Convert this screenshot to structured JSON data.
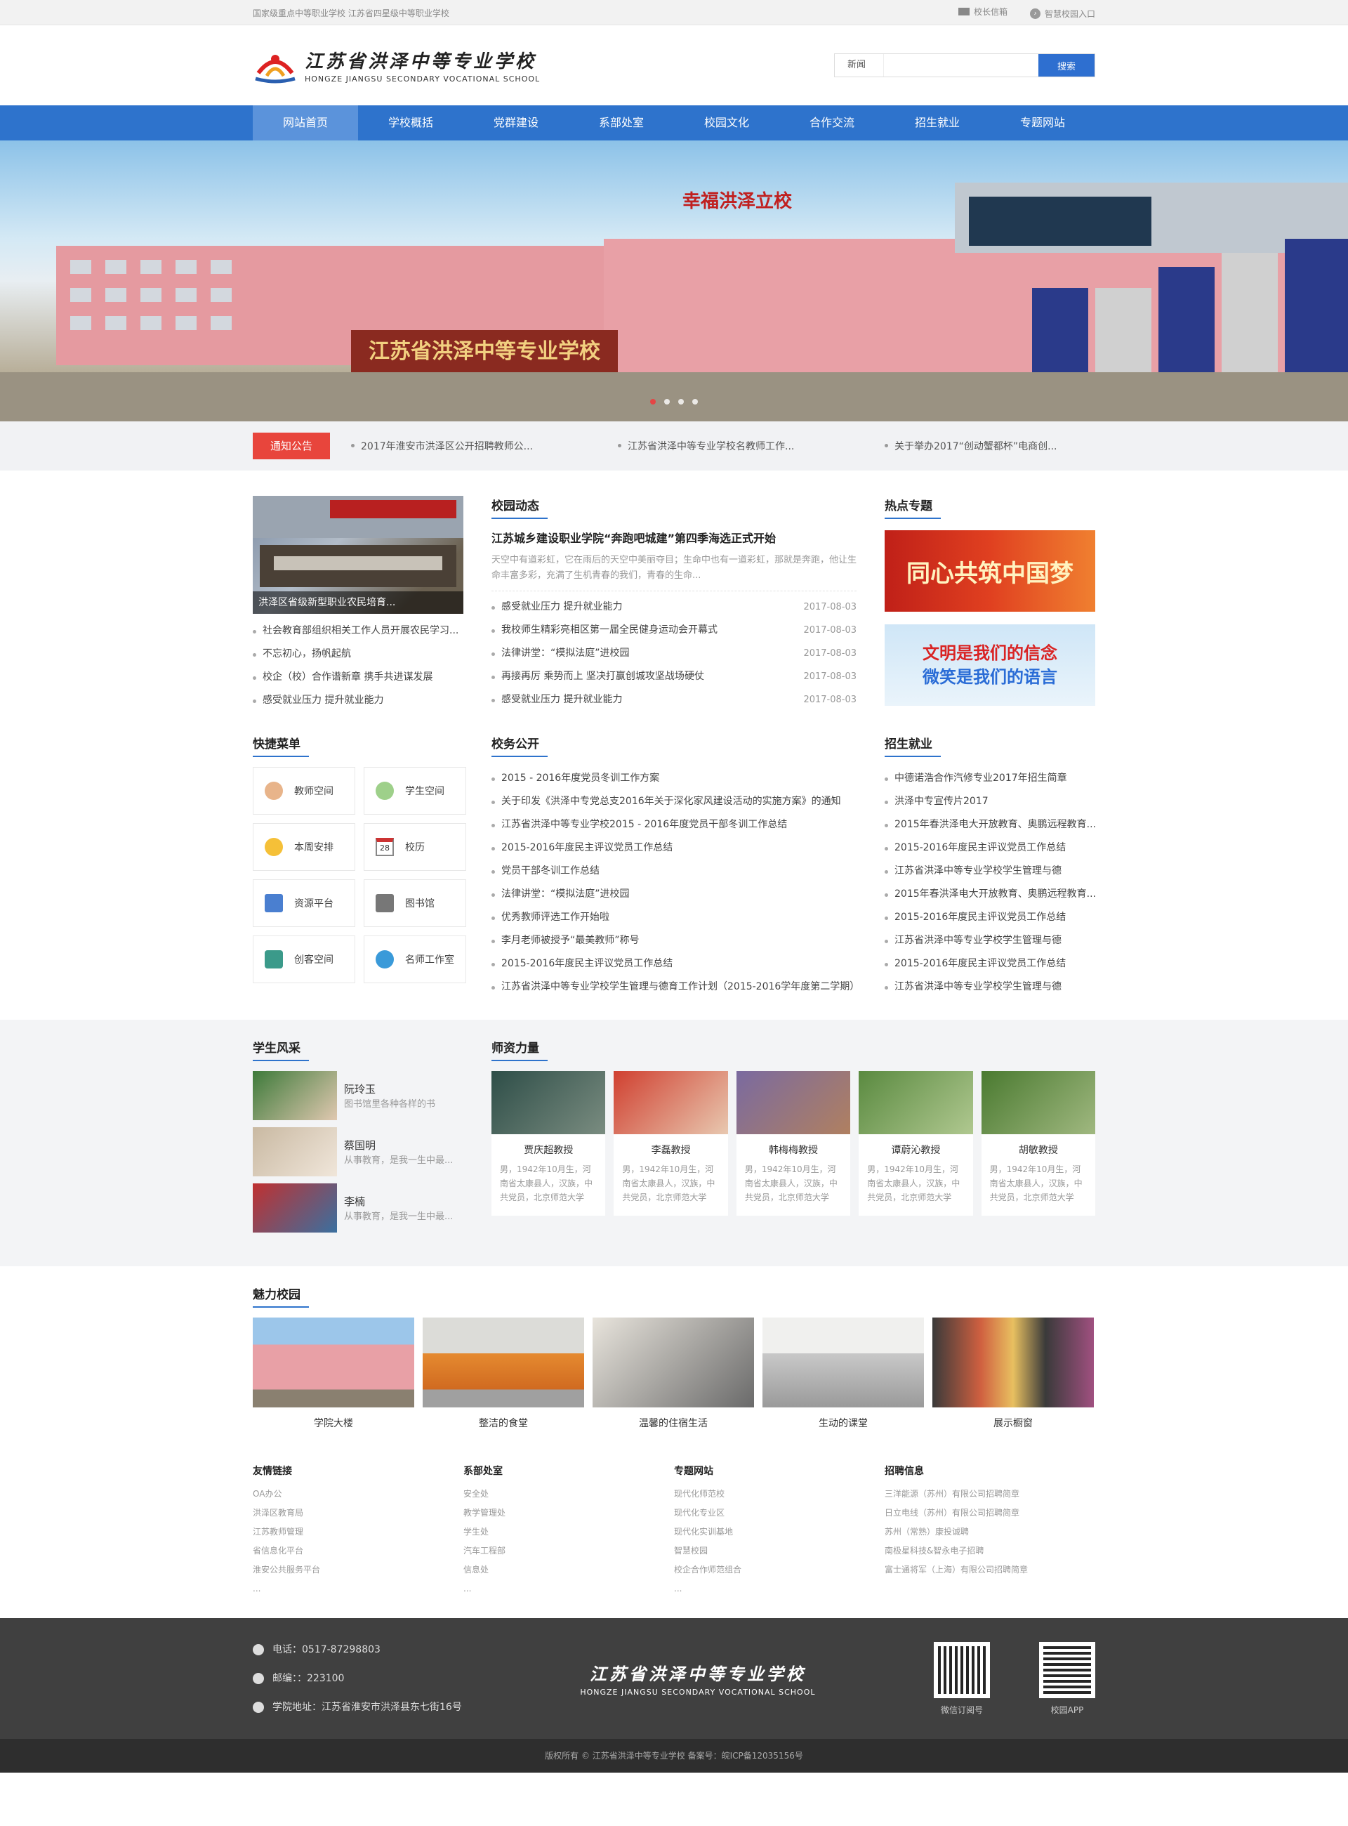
{
  "topbar": {
    "left": "国家级重点中等职业学校    江苏省四星级中等职业学校",
    "principal_mail": "校长信箱",
    "smart_campus": "智慧校园入口"
  },
  "logo": {
    "cn": "江苏省洪泽中等专业学校",
    "en": "HONGZE JIANGSU SECONDARY VOCATIONAL SCHOOL"
  },
  "search": {
    "label": "新闻",
    "placeholder": "",
    "button": "搜索"
  },
  "nav": [
    "网站首页",
    "学校概括",
    "党群建设",
    "系部处室",
    "校园文化",
    "合作交流",
    "招生就业",
    "专题网站"
  ],
  "banner": {
    "sign": "江苏省洪泽中等专业学校",
    "slogan": "幸福洪泽立校"
  },
  "notice": {
    "tag": "通知公告",
    "items": [
      "2017年淮安市洪泽区公开招聘教师公...",
      "江苏省洪泽中等专业学校名教师工作...",
      "关于举办2017“创动蟹都杯”电商创..."
    ]
  },
  "photo_caption": "洪泽区省级新型职业农民培育...",
  "left_list": [
    "社会教育部组织相关工作人员开展农民学习...",
    "不忘初心，扬帆起航",
    "校企（校）合作谱新章 携手共进谋发展",
    "感受就业压力 提升就业能力"
  ],
  "campus": {
    "title": "校园动态",
    "headline": "江苏城乡建设职业学院“奔跑吧城建”第四季海选正式开始",
    "summary": "天空中有道彩虹，它在雨后的天空中美丽夺目；生命中也有一道彩虹，那就是奔跑，他让生命丰富多彩，充满了生机青春的我们，青春的生命...",
    "items": [
      {
        "t": "感受就业压力 提升就业能力",
        "d": "2017-08-03"
      },
      {
        "t": "我校师生精彩亮相区第一届全民健身运动会开幕式",
        "d": "2017-08-03"
      },
      {
        "t": "法律讲堂：“模拟法庭”进校园",
        "d": "2017-08-03"
      },
      {
        "t": "再接再厉 乘势而上 坚决打赢创城攻坚战场硬仗",
        "d": "2017-08-03"
      },
      {
        "t": "感受就业压力 提升就业能力",
        "d": "2017-08-03"
      }
    ]
  },
  "hot": {
    "title": "热点专题",
    "b1": "同心共筑中国梦",
    "b2a": "文明是我们的信念",
    "b2b": "微笑是我们的语言"
  },
  "quick": {
    "title": "快捷菜单",
    "items": [
      "教师空间",
      "学生空间",
      "本周安排",
      "校历",
      "资源平台",
      "图书馆",
      "创客空间",
      "名师工作室"
    ],
    "cal": "28"
  },
  "affairs": {
    "title": "校务公开",
    "items": [
      "2015 - 2016年度党员冬训工作方案",
      "关于印发《洪泽中专党总支2016年关于深化家风建设活动的实施方案》的通知",
      "江苏省洪泽中等专业学校2015 - 2016年度党员干部冬训工作总结",
      "2015-2016年度民主评议党员工作总结",
      "党员干部冬训工作总结",
      "法律讲堂：“模拟法庭”进校园",
      "优秀教师评选工作开始啦",
      "李月老师被授予“最美教师”称号",
      "2015-2016年度民主评议党员工作总结",
      "江苏省洪泽中等专业学校学生管理与德育工作计划（2015-2016学年度第二学期）"
    ]
  },
  "enroll": {
    "title": "招生就业",
    "items": [
      "中德诺浩合作汽修专业2017年招生简章",
      "洪泽中专宣传片2017",
      "2015年春洪泽电大开放教育、奥鹏远程教育...",
      "2015-2016年度民主评议党员工作总结",
      "江苏省洪泽中等专业学校学生管理与德",
      "2015年春洪泽电大开放教育、奥鹏远程教育...",
      "2015-2016年度民主评议党员工作总结",
      "江苏省洪泽中等专业学校学生管理与德",
      "2015-2016年度民主评议党员工作总结",
      "江苏省洪泽中等专业学校学生管理与德"
    ]
  },
  "students": {
    "title": "学生风采",
    "items": [
      {
        "n": "阮玲玉",
        "d": "图书馆里各种各样的书"
      },
      {
        "n": "蔡国明",
        "d": "从事教育，是我一生中最..."
      },
      {
        "n": "李楠",
        "d": "从事教育，是我一生中最..."
      }
    ]
  },
  "teachers": {
    "title": "师资力量",
    "desc": "男，1942年10月生，河南省太康县人，汉族，中共党员，北京师范大学",
    "items": [
      "贾庆超教授",
      "李磊教授",
      "韩梅梅教授",
      "谭蔚沁教授",
      "胡敏教授"
    ]
  },
  "gallery": {
    "title": "魅力校园",
    "items": [
      "学院大楼",
      "整洁的食堂",
      "温馨的住宿生活",
      "生动的课堂",
      "展示橱窗"
    ]
  },
  "links": [
    {
      "h": "友情链接",
      "items": [
        "OA办公",
        "洪泽区教育局",
        "江苏教师管理",
        "省信息化平台",
        "淮安公共服务平台",
        "..."
      ]
    },
    {
      "h": "系部处室",
      "items": [
        "安全处",
        "教学管理处",
        "学生处",
        "汽车工程部",
        "信息处",
        "..."
      ]
    },
    {
      "h": "专题网站",
      "items": [
        "现代化师范校",
        "现代化专业区",
        "现代化实训基地",
        "智慧校园",
        "校企合作师范组合",
        "..."
      ]
    },
    {
      "h": "招聘信息",
      "items": [
        "三洋能源（苏州）有限公司招聘简章",
        "日立电线（苏州）有限公司招聘简章",
        "苏州（常熟）康投诚聘",
        "南极星科技&智永电子招聘",
        "富士通将军（上海）有限公司招聘简章"
      ]
    }
  ],
  "footer": {
    "phone": "电话：0517-87298803",
    "post": "邮编：：223100",
    "addr": "学院地址：江苏省淮安市洪泽县东七街16号",
    "qr1": "微信订阅号",
    "qr2": "校园APP",
    "copyright": "版权所有 © 江苏省洪泽中等专业学校     备案号：皖ICP备12035156号"
  },
  "colors": {
    "brand": "#2e73cc",
    "notice_red": "#e8453c",
    "footer": "#404040"
  }
}
